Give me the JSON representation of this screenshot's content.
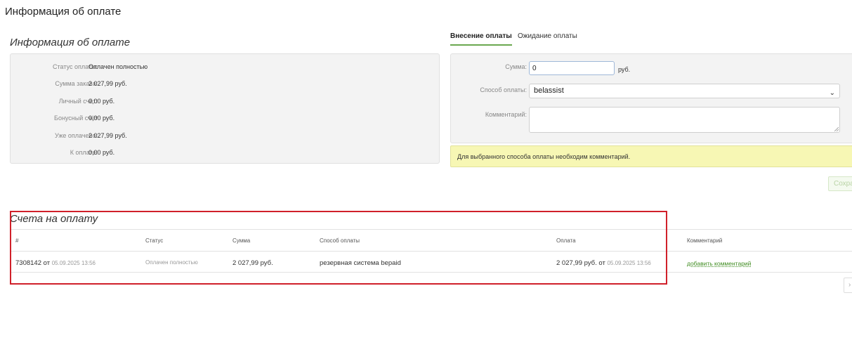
{
  "page": {
    "title": "Информация об оплате"
  },
  "info": {
    "title": "Информация об оплате",
    "rows": [
      {
        "label": "Статус оплаты:",
        "value": "Оплачен полностью"
      },
      {
        "label": "Сумма заказа:",
        "value": "2 027,99 руб."
      },
      {
        "label": "Личный счёт:",
        "value": "0,00 руб."
      },
      {
        "label": "Бонусный счёт",
        "value": "0,00 руб."
      },
      {
        "label": "Уже оплачено:",
        "value": "2 027,99 руб."
      },
      {
        "label": "К оплате:",
        "value": "0,00 руб."
      }
    ]
  },
  "tabs": [
    {
      "label": "Внесение оплаты",
      "active": true
    },
    {
      "label": "Ожидание оплаты",
      "active": false
    }
  ],
  "form": {
    "sum_label": "Сумма:",
    "sum_value": "0",
    "sum_unit": "руб.",
    "method_label": "Способ оплаты:",
    "method_value": "belassist",
    "comment_label": "Комментарий:",
    "comment_value": ""
  },
  "alert": {
    "text": "Для выбранного способа оплаты необходим комментарий."
  },
  "save_button": {
    "label": "Сохранить"
  },
  "invoices": {
    "title": "Счета на оплату",
    "headers": [
      "#",
      "Статус",
      "Сумма",
      "Способ оплаты",
      "Оплата",
      "Комментарий"
    ],
    "rows": [
      {
        "number": "7308142",
        "from_word": "от",
        "date": "05.09.2025 13:56",
        "status": "Оплачен полностью",
        "sum": "2 027,99 руб.",
        "method": "резервная система bepaid",
        "payment": "2 027,99 руб. от",
        "payment_date": "05.09.2025 13:56",
        "comment_link": "добавить комментарий"
      }
    ]
  },
  "colors": {
    "accent": "#6aa84f",
    "link": "#3d8b1e",
    "highlight": "#d0202a",
    "alert_bg": "#f7f7b4"
  }
}
